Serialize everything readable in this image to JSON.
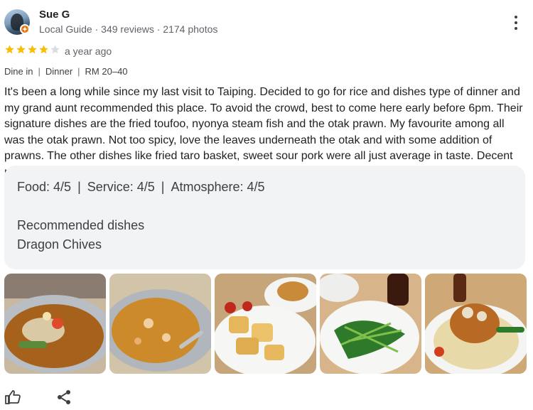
{
  "reviewer": {
    "name": "Sue G",
    "subtitle": "Local Guide · 349 reviews · 2174 photos"
  },
  "rating": {
    "stars": 4,
    "max": 5,
    "date": "a year ago"
  },
  "meta": {
    "service": "Dine in",
    "meal": "Dinner",
    "price": "RM 20–40"
  },
  "review_text": "It's been a long while since my last visit to Taiping. Decided to go for rice and dishes type of dinner and my grand aunt recommended this place. To avoid the crowd, best to come here early before 6pm. Their signature dishes are the fried toufoo, nyonya steam fish and the otak prawn. My favourite among all was the otak prawn. Not too spicy, love the leaves underneath the otak and with some addition of prawns. The other dishes like fried taro basket, sweet sour pork were all just average in taste. Decent place for dinner.",
  "ratings": {
    "food": "Food: 4/5",
    "service": "Service: 4/5",
    "atmosphere": "Atmosphere: 4/5"
  },
  "recommended": {
    "heading": "Recommended dishes",
    "dish": "Dragon Chives"
  },
  "icons": {
    "badge": "local-guide-badge-icon",
    "menu": "more-vert-icon",
    "like": "thumb-up-icon",
    "share": "share-icon"
  },
  "colors": {
    "star_filled": "#fbbc04",
    "star_empty": "#dadce0",
    "badge": "#e8710a",
    "box_bg": "#f1f3f4"
  }
}
